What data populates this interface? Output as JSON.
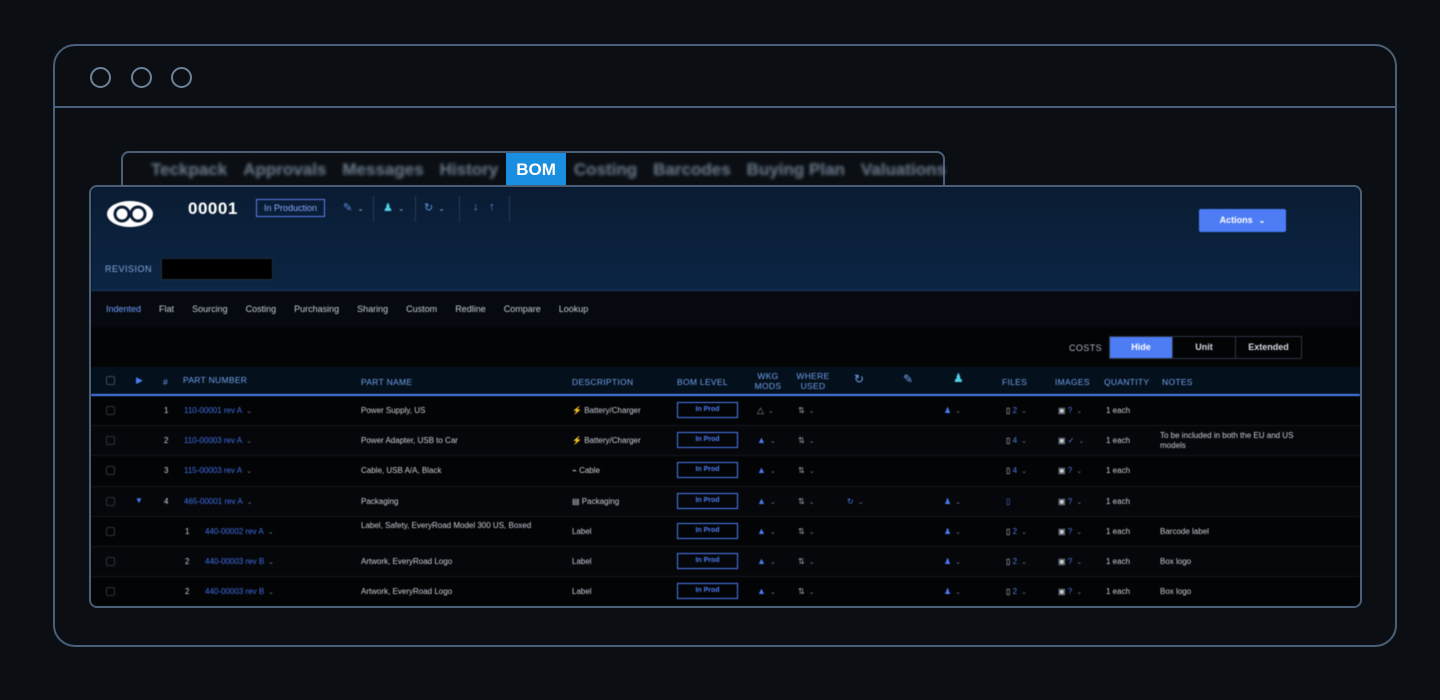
{
  "tabs": [
    {
      "label": "Teckpack"
    },
    {
      "label": "Approvals"
    },
    {
      "label": "Messages"
    },
    {
      "label": "History"
    },
    {
      "label": "BOM",
      "active": true
    },
    {
      "label": "Costing"
    },
    {
      "label": "Barcodes"
    },
    {
      "label": "Buying Plan"
    },
    {
      "label": "Valuations"
    }
  ],
  "header": {
    "part_id": "00001",
    "status": "In Production",
    "actions_label": "Actions",
    "revision_label": "REVISION",
    "revision_value": ""
  },
  "subnav": [
    "Indented",
    "Flat",
    "Sourcing",
    "Costing",
    "Purchasing",
    "Sharing",
    "Custom",
    "Redline",
    "Compare",
    "Lookup"
  ],
  "costs": {
    "label": "COSTS",
    "options": [
      "Hide",
      "Unit",
      "Extended"
    ],
    "selected": "Hide"
  },
  "columns": {
    "num": "#",
    "part_number": "PART NUMBER",
    "part_name": "PART NAME",
    "description": "DESCRIPTION",
    "bom_level": "BOM LEVEL",
    "wkg_mods_1": "WKG",
    "wkg_mods_2": "MODS",
    "where_used_1": "WHERE",
    "where_used_2": "USED",
    "files": "FILES",
    "images": "IMAGES",
    "quantity": "QUANTITY",
    "notes": "NOTES"
  },
  "rows": [
    {
      "num": "1",
      "part_number": "110-00001 rev A",
      "part_name": "Power Supply, US",
      "description": "Battery/Charger",
      "bom_level": "In Prod",
      "files": "2",
      "images": "?",
      "quantity": "1 each",
      "notes": ""
    },
    {
      "num": "2",
      "part_number": "110-00003 rev A",
      "part_name": "Power Adapter, USB to Car",
      "description": "Battery/Charger",
      "bom_level": "In Prod",
      "files": "4",
      "images": "✓",
      "quantity": "1 each",
      "notes": "To be included in both the EU and US models"
    },
    {
      "num": "3",
      "part_number": "115-00003 rev A",
      "part_name": "Cable, USB A/A, Black",
      "description": "Cable",
      "bom_level": "In Prod",
      "files": "4",
      "images": "?",
      "quantity": "1 each",
      "notes": ""
    },
    {
      "num": "4",
      "part_number": "465-00001 rev A",
      "part_name": "Packaging",
      "description": "Packaging",
      "bom_level": "In Prod",
      "files": "",
      "images": "?",
      "quantity": "1 each",
      "notes": ""
    },
    {
      "num": "1",
      "part_number": "440-00002 rev A",
      "part_name": "Label, Safety, EveryRoad Model 300 US, Boxed",
      "description": "Label",
      "bom_level": "In Prod",
      "files": "2",
      "images": "?",
      "quantity": "1 each",
      "notes": "Barcode label"
    },
    {
      "num": "2",
      "part_number": "440-00003 rev B",
      "part_name": "Artwork, EveryRoad Logo",
      "description": "Label",
      "bom_level": "In Prod",
      "files": "2",
      "images": "?",
      "quantity": "1 each",
      "notes": "Box logo"
    },
    {
      "num": "2",
      "part_number": "440-00003 rev B",
      "part_name": "Artwork, EveryRoad Logo",
      "description": "Label",
      "bom_level": "In Prod",
      "files": "2",
      "images": "?",
      "quantity": "1 each",
      "notes": "Box logo"
    }
  ],
  "colors": {
    "accent": "#4d7cf5",
    "tab_active": "#1a8fe0",
    "header_bg": "#0c2544",
    "frame": "#4a5f78"
  }
}
